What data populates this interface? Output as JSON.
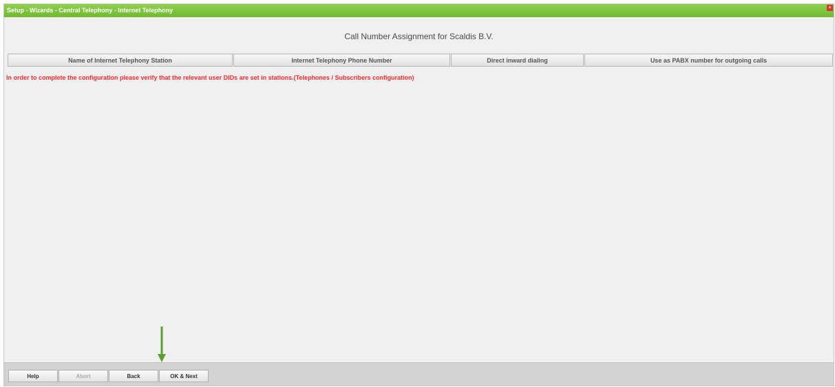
{
  "window": {
    "title": "Setup - Wizards - Central Telephony - Internet Telephony",
    "close_glyph": "×"
  },
  "heading": "Call Number Assignment for Scaldis B.V.",
  "table": {
    "columns": [
      "Name of Internet Telephony Station",
      "Internet Telephony Phone Number",
      "Direct inward dialing",
      "Use as PABX number for outgoing calls"
    ]
  },
  "notice": "In order to complete the configuration please verify that the relevant user DIDs are set in stations.(Telephones / Subscribers configuration)",
  "footer": {
    "help": "Help",
    "abort": "Abort",
    "back": "Back",
    "ok_next": "OK & Next"
  },
  "colors": {
    "titlebar": "#7cc23c",
    "notice": "#ff2a2a",
    "arrow": "#5a9e2f"
  },
  "annotation_arrow_icon": "down-arrow-icon"
}
